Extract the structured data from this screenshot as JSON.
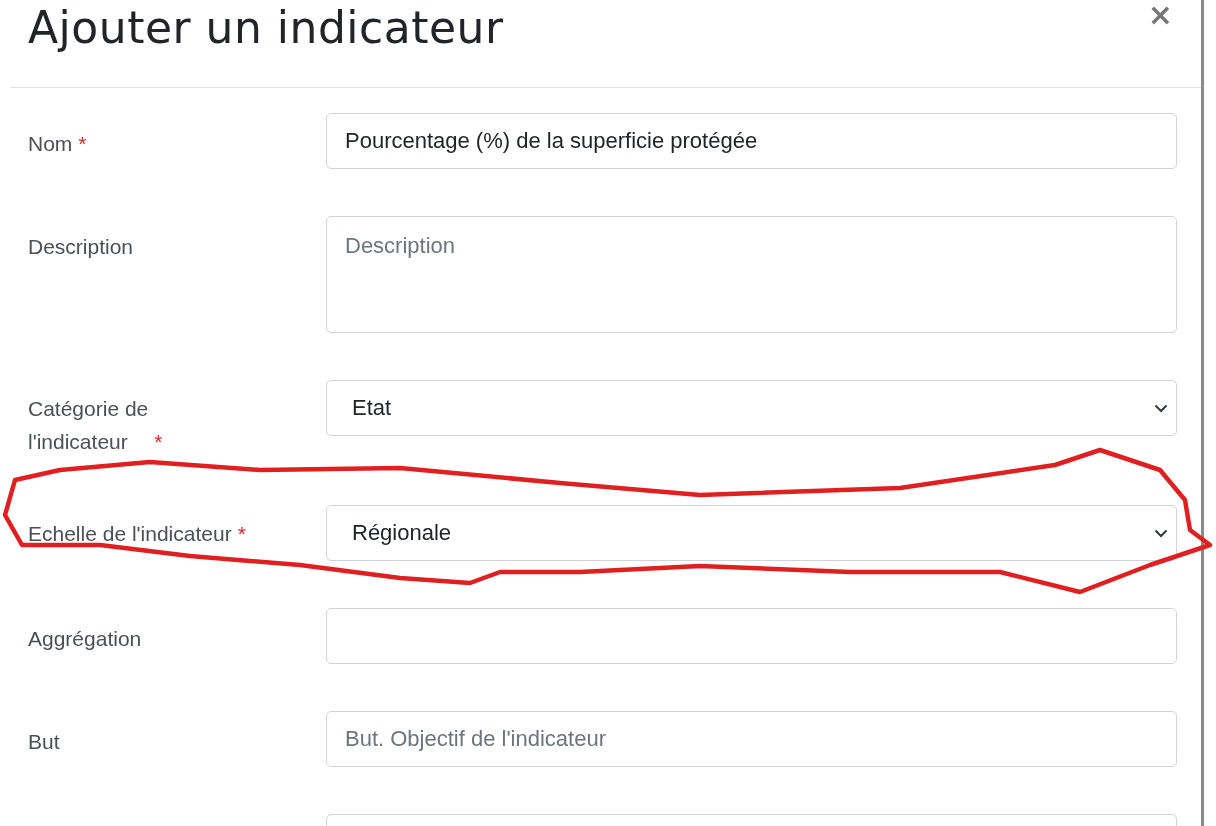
{
  "dialog": {
    "title": "Ajouter un indicateur",
    "close": "×"
  },
  "fields": [
    {
      "kind": "text",
      "label": "Nom",
      "required_mark": "*",
      "value": "Pourcentage (%) de la superficie protégée"
    },
    {
      "kind": "textarea",
      "label": "Description",
      "placeholder": "Description"
    },
    {
      "kind": "select",
      "label": "Catégorie de\nl'indicateur",
      "required_mark": "*",
      "value": "Etat"
    },
    {
      "kind": "select",
      "label": "Echelle de l'indicateur",
      "required_mark": "*",
      "value": "Régionale"
    },
    {
      "kind": "text",
      "label": "Aggrégation"
    },
    {
      "kind": "text",
      "label": "But",
      "placeholder": "But. Objectif de l'indicateur"
    },
    {
      "kind": "text"
    }
  ]
}
